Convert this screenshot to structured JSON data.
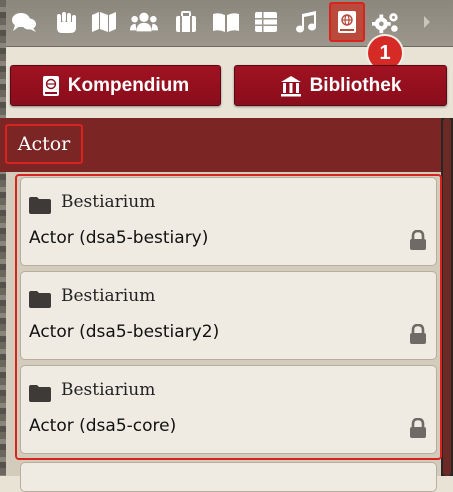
{
  "tabs": [
    {
      "name": "chat",
      "icon": "chat-bubbles-icon"
    },
    {
      "name": "combat",
      "icon": "fist-icon"
    },
    {
      "name": "scenes",
      "icon": "map-icon"
    },
    {
      "name": "actors",
      "icon": "users-icon"
    },
    {
      "name": "items",
      "icon": "suitcase-icon"
    },
    {
      "name": "journal",
      "icon": "book-open-icon"
    },
    {
      "name": "tables",
      "icon": "table-icon"
    },
    {
      "name": "playlists",
      "icon": "music-icon"
    },
    {
      "name": "compendium",
      "icon": "atlas-icon",
      "active": true
    },
    {
      "name": "settings",
      "icon": "cogs-icon"
    }
  ],
  "step_badge": "1",
  "buttons": {
    "kompendium": "Kompendium",
    "bibliothek": "Bibliothek"
  },
  "folder": {
    "title": "Actor"
  },
  "packs": [
    {
      "folder": "Bestiarium",
      "name": "Actor (dsa5-bestiary)",
      "locked": true
    },
    {
      "folder": "Bestiarium",
      "name": "Actor (dsa5-bestiary2)",
      "locked": true
    },
    {
      "folder": "Bestiarium",
      "name": "Actor (dsa5-core)",
      "locked": true
    }
  ],
  "colors": {
    "accent_red": "#8a0d1b",
    "highlight_red": "#d9231f",
    "folder_header": "#7b2524"
  }
}
